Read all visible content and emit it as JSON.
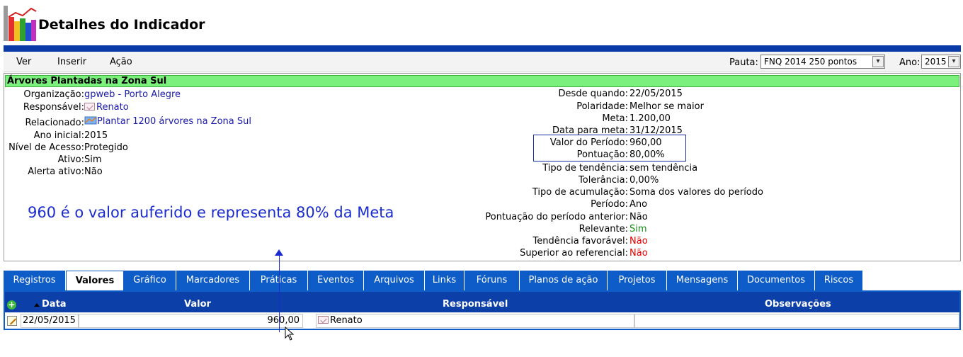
{
  "header": {
    "title": "Detalhes do Indicador"
  },
  "menu": {
    "items": [
      "Ver",
      "Inserir",
      "Ação"
    ]
  },
  "filters": {
    "pauta_label": "Pauta:",
    "pauta_value": "FNQ 2014 250 pontos",
    "ano_label": "Ano:",
    "ano_value": "2015"
  },
  "indicator": {
    "title": "Árvores Plantadas na Zona Sul",
    "left": [
      {
        "label": "Organização:",
        "value": "gpweb - Porto Alegre"
      },
      {
        "label": "Responsável:",
        "value": "Renato"
      },
      {
        "label": "Relacionado:",
        "value": "Plantar 1200 árvores na Zona Sul"
      },
      {
        "label": "Ano inicial:",
        "value": "2015"
      },
      {
        "label": "Nível de Acesso:",
        "value": "Protegido"
      },
      {
        "label": "Ativo:",
        "value": "Sim"
      },
      {
        "label": "Alerta ativo:",
        "value": "Não"
      }
    ],
    "right": [
      {
        "label": "Desde quando:",
        "value": "22/05/2015"
      },
      {
        "label": "Polaridade:",
        "value": "Melhor se maior"
      },
      {
        "label": "Meta:",
        "value": "1.200,00"
      },
      {
        "label": "Data para meta:",
        "value": "31/12/2015"
      },
      {
        "label": "Valor do Período:",
        "value": "960,00"
      },
      {
        "label": "Pontuação:",
        "value": "80,00%"
      },
      {
        "label": "Tipo de tendência:",
        "value": "sem tendência"
      },
      {
        "label": "Tolerância:",
        "value": "0,00%"
      },
      {
        "label": "Tipo de acumulação:",
        "value": "Soma dos valores do período"
      },
      {
        "label": "Período:",
        "value": "Ano"
      },
      {
        "label": "Pontuação do período anterior:",
        "value": "Não"
      },
      {
        "label": "Relevante:",
        "value": "Sim"
      },
      {
        "label": "Tendência favorável:",
        "value": "Não"
      },
      {
        "label": "Superior ao referencial:",
        "value": "Não"
      }
    ]
  },
  "annotation": {
    "text": "960 é o valor auferido e representa 80% da Meta"
  },
  "tabs": [
    "Registros",
    "Valores",
    "Gráfico",
    "Marcadores",
    "Práticas",
    "Eventos",
    "Arquivos",
    "Links",
    "Fóruns",
    "Planos de ação",
    "Projetos",
    "Mensagens",
    "Documentos",
    "Riscos"
  ],
  "active_tab": "Valores",
  "grid": {
    "headers": {
      "data": "Data",
      "valor": "Valor",
      "responsavel": "Responsável",
      "observacoes": "Observações"
    },
    "rows": [
      {
        "data": "22/05/2015",
        "valor": "960,00",
        "responsavel": "Renato",
        "observacoes": ""
      }
    ]
  }
}
